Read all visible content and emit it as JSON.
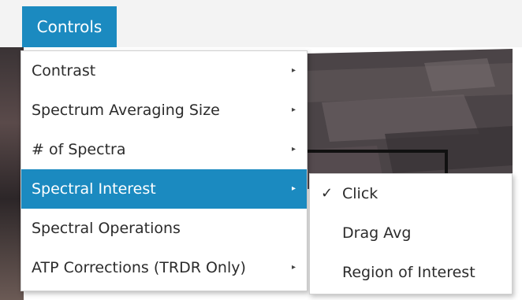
{
  "menubar": {
    "controls_label": "Controls"
  },
  "main_menu": {
    "items": [
      {
        "label": "Contrast",
        "has_submenu": true
      },
      {
        "label": "Spectrum Averaging Size",
        "has_submenu": true
      },
      {
        "label": "# of Spectra",
        "has_submenu": true
      },
      {
        "label": "Spectral Interest",
        "has_submenu": true,
        "active": true
      },
      {
        "label": "Spectral Operations",
        "has_submenu": false
      },
      {
        "label": "ATP Corrections (TRDR Only)",
        "has_submenu": true
      }
    ],
    "arrow_glyph": "▸"
  },
  "sub_menu": {
    "items": [
      {
        "label": "Click",
        "checked": true
      },
      {
        "label": "Drag Avg",
        "checked": false
      },
      {
        "label": "Region of Interest",
        "checked": false
      }
    ],
    "check_glyph": "✓"
  },
  "colors": {
    "accent": "#1b8ac0",
    "menubar_bg": "#f3f3f3",
    "menu_text": "#2b2b2b"
  }
}
